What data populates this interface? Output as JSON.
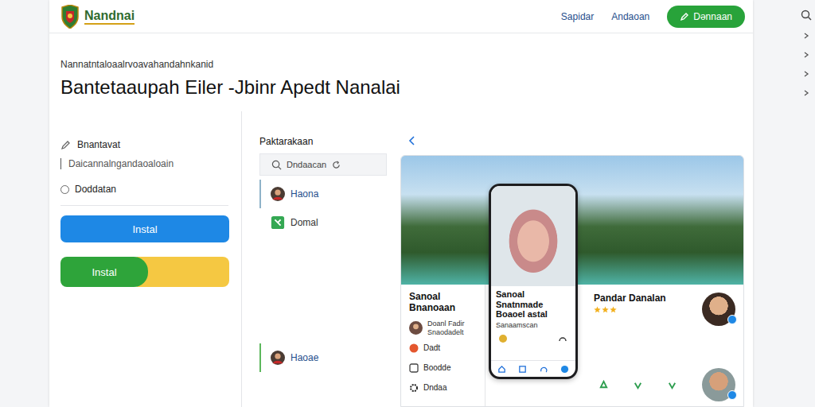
{
  "header": {
    "logo": "Nandnai",
    "nav": [
      "Sapidar",
      "Andaoan"
    ],
    "cta": "Dənnaan"
  },
  "hero": {
    "subtitle": "Nannatntaloaalrvoavahandahnkanid",
    "title": "Bantetaaupah Eiler -Jbinr Apedt Nanalai"
  },
  "left_panel": {
    "items": [
      {
        "kind": "edit",
        "label": "Bnantavat"
      },
      {
        "kind": "text",
        "label": "Daicannalngandaoaloain"
      }
    ],
    "option": {
      "label": "Doddatan",
      "selected": false
    },
    "buttons": [
      {
        "kind": "primary",
        "label": "Instal"
      },
      {
        "kind": "split",
        "label": "Instal"
      }
    ]
  },
  "contacts": {
    "title": "Paktarakaan",
    "search": {
      "placeholder": "Dndaacan"
    },
    "items": [
      {
        "kind": "avatar",
        "label": "Haona",
        "selected": true
      },
      {
        "kind": "app",
        "label": "Domal",
        "selected": false
      },
      {
        "kind": "avatar",
        "label": "Haoae",
        "selected": true
      }
    ]
  },
  "feed": {
    "left": {
      "title": "Sanoal Bnanoaan",
      "rows": [
        {
          "kind": "person",
          "label": "Doanl Fadir",
          "sub": "Snaodadelt"
        },
        {
          "kind": "alert",
          "label": "Dadt"
        },
        {
          "kind": "box",
          "label": "Boodde"
        },
        {
          "kind": "gear",
          "label": "Dndaa"
        }
      ]
    },
    "phone": {
      "title": "Sanoal Snatnmade Boaoel astal",
      "sub": "Sanaamscan"
    },
    "right": {
      "title": "Pandar Danalan",
      "stars": 3
    }
  }
}
